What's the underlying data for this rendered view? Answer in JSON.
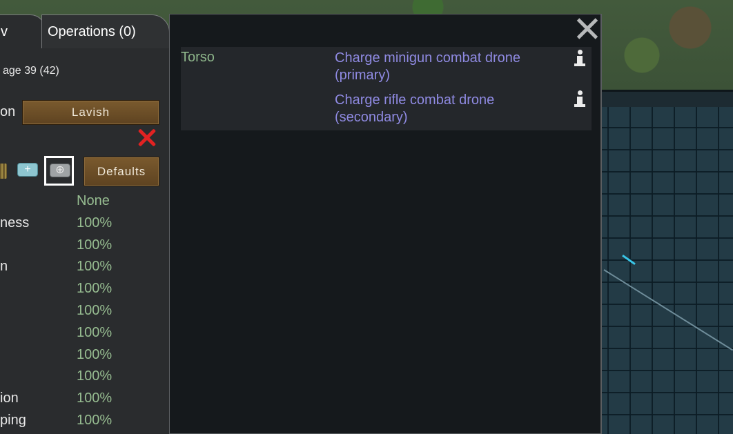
{
  "tabs": {
    "overview": "v",
    "operations": "Operations (0)"
  },
  "pawn": {
    "age_text": "age 39 (42)"
  },
  "food": {
    "label": "on",
    "value": "Lavish"
  },
  "medicine": {
    "defaults_label": "Defaults",
    "icons": [
      "herbal-medicine-icon",
      "industrial-medicine-icon",
      "ultratech-medicine-icon"
    ],
    "selected": "ultratech-medicine-icon"
  },
  "capacities": {
    "header_value": "None",
    "rows": [
      {
        "name": "ness",
        "value": "100%"
      },
      {
        "name": "",
        "value": "100%"
      },
      {
        "name": "n",
        "value": "100%"
      },
      {
        "name": "",
        "value": "100%"
      },
      {
        "name": "",
        "value": "100%"
      },
      {
        "name": "",
        "value": "100%"
      },
      {
        "name": "",
        "value": "100%"
      },
      {
        "name": "",
        "value": "100%"
      },
      {
        "name": "ion",
        "value": "100%"
      },
      {
        "name": "ping",
        "value": "100%"
      }
    ]
  },
  "health": {
    "body_part": "Torso",
    "hediffs": [
      {
        "label": "Charge minigun combat drone (primary)"
      },
      {
        "label": "Charge rifle combat drone (secondary)"
      }
    ]
  },
  "colors": {
    "body_part": "#8db58a",
    "hediff": "#8f8ae2",
    "capacity_value": "#97bd91",
    "cancel": "#e12222"
  }
}
